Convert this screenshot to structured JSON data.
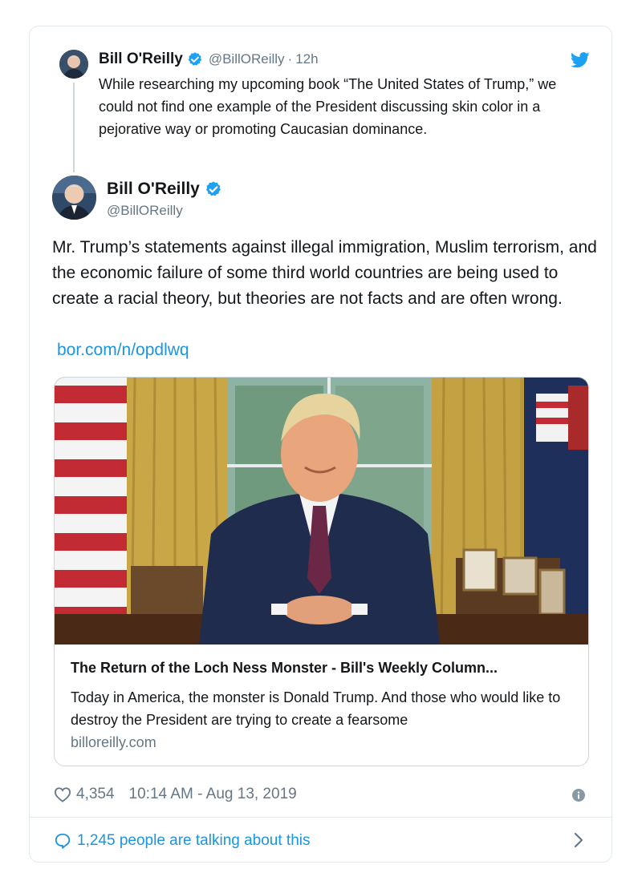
{
  "quoted_tweet": {
    "author_name": "Bill O'Reilly",
    "handle": "@BillOReilly",
    "separator": "·",
    "time": "12h",
    "text": "While researching my upcoming book “The United States of Trump,” we could not find one example of the President discussing skin color in a pejorative way or promoting Caucasian dominance."
  },
  "main_tweet": {
    "author_name": "Bill O'Reilly",
    "handle": "@BillOReilly",
    "text": "Mr. Trump’s statements against illegal immigration, Muslim terrorism, and the economic failure of some third world countries are being used to create a racial theory, but theories are not facts and are often wrong.",
    "link": "bor.com/n/opdlwq"
  },
  "link_card": {
    "title": "The Return of the Loch Ness Monster - Bill's Weekly Column...",
    "description": "Today in America, the monster is Donald Trump.  And those who would like to destroy the President are trying to create a fearsome",
    "domain": "billoreilly.com"
  },
  "footer": {
    "likes": "4,354",
    "timestamp": "10:14 AM - Aug 13, 2019",
    "talking": "1,245 people are talking about this"
  },
  "icons": {
    "verified": "verified-badge-icon",
    "brand": "twitter-bird-icon",
    "like": "heart-icon",
    "info": "info-icon",
    "reply": "speech-bubble-icon",
    "more": "chevron-right-icon"
  },
  "colors": {
    "twitter_blue": "#1da1f2",
    "link_blue": "#1b95e0",
    "muted_text": "#657786",
    "border": "#e1e8ed"
  }
}
